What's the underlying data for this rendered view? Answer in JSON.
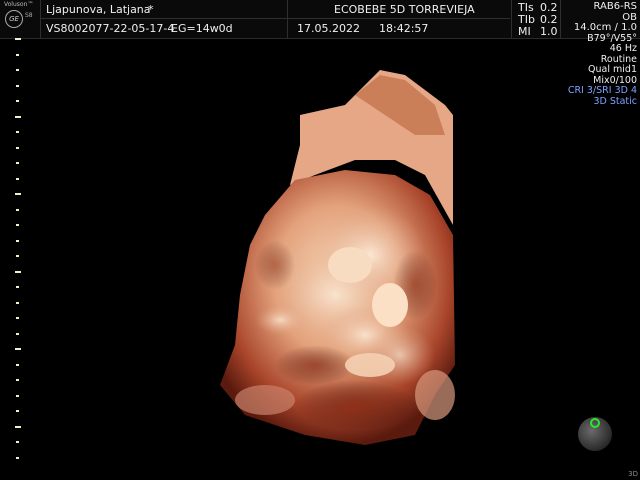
{
  "header": {
    "brand": "Voluson™",
    "logo": "GE",
    "model": "S8",
    "patient_name": "Ljapunova, Latjana",
    "patient_marker": "*",
    "exam_id": "VS8002077-22-05-17-4",
    "ega": "EG=14w0d",
    "facility": "ECOBEBE 5D TORREVIEJA",
    "date": "17.05.2022",
    "time": "18:42:57",
    "tis_label": "TIs",
    "tis_value": "0.2",
    "tib_label": "TIb",
    "tib_value": "0.2",
    "mi_label": "MI",
    "mi_value": "1.0"
  },
  "params": {
    "probe": "RAB6-RS",
    "preset": "OB",
    "depth": "14.0cm / 1.0",
    "angle": "B79°/V55°",
    "frequency": "46 Hz",
    "mode": "Routine",
    "quality": "Qual mid1",
    "mix": "Mix0/100",
    "cri": "CRI 3/SRI 3D 4",
    "render": "3D Static"
  },
  "footer": {
    "corner": "3D"
  },
  "colors": {
    "ruler_tick": "#f1f1c8",
    "blue_text": "#7fa0ff",
    "orientation_dot": "#2ee62e"
  }
}
